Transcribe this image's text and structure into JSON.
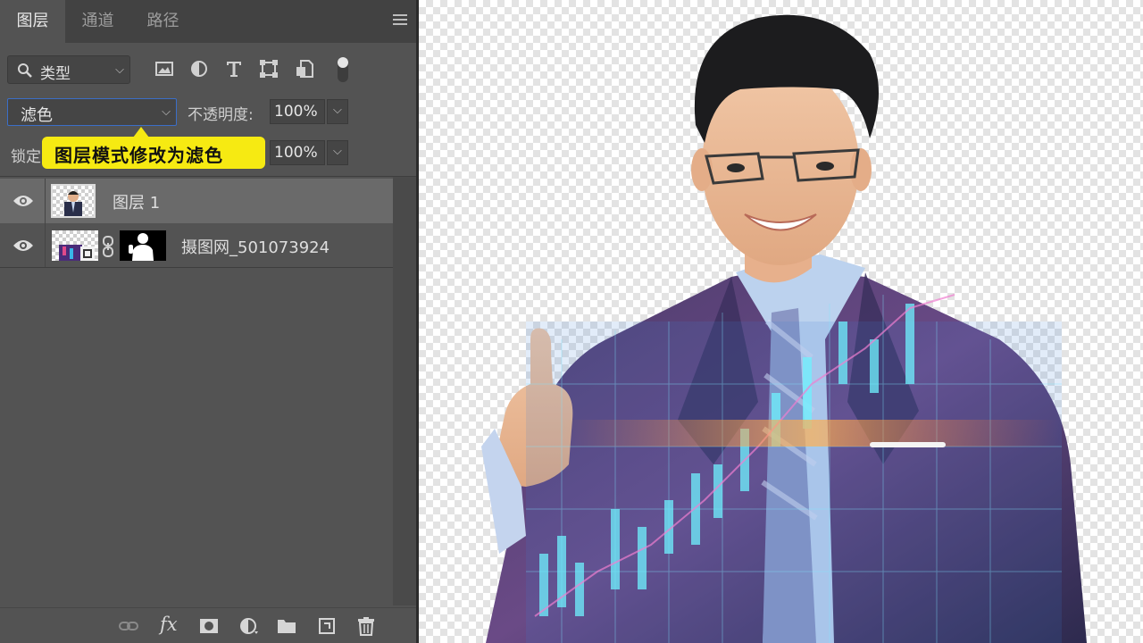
{
  "tabs": [
    {
      "label": "图层",
      "active": true
    },
    {
      "label": "通道",
      "active": false
    },
    {
      "label": "路径",
      "active": false
    }
  ],
  "filter": {
    "kind_label": "类型",
    "icons": [
      "image-filter-icon",
      "adjustment-filter-icon",
      "type-filter-icon",
      "shape-filter-icon",
      "smart-object-filter-icon",
      "filter-toggle-icon"
    ]
  },
  "blend": {
    "mode": "滤色",
    "opacity_label": "不透明度:",
    "opacity_value": "100%"
  },
  "lock": {
    "label": "锁定",
    "fill_value": "100%"
  },
  "callout": {
    "text": "图层模式修改为滤色",
    "color": "#f6ea12"
  },
  "layers": [
    {
      "name": "图层 1",
      "selected": true,
      "visible": true
    },
    {
      "name": "摄图网_501073924",
      "selected": false,
      "visible": true,
      "has_mask": true
    }
  ],
  "bottom_icons": [
    "link-layers-icon",
    "fx-icon",
    "add-mask-icon",
    "adjustment-layer-icon",
    "new-group-icon",
    "new-layer-icon",
    "delete-icon"
  ],
  "bottom_fx_label": "fx",
  "colors": {
    "panel_bg": "#535353",
    "selected_row": "#6a6a6a",
    "focus_border": "#3b6ec7"
  }
}
